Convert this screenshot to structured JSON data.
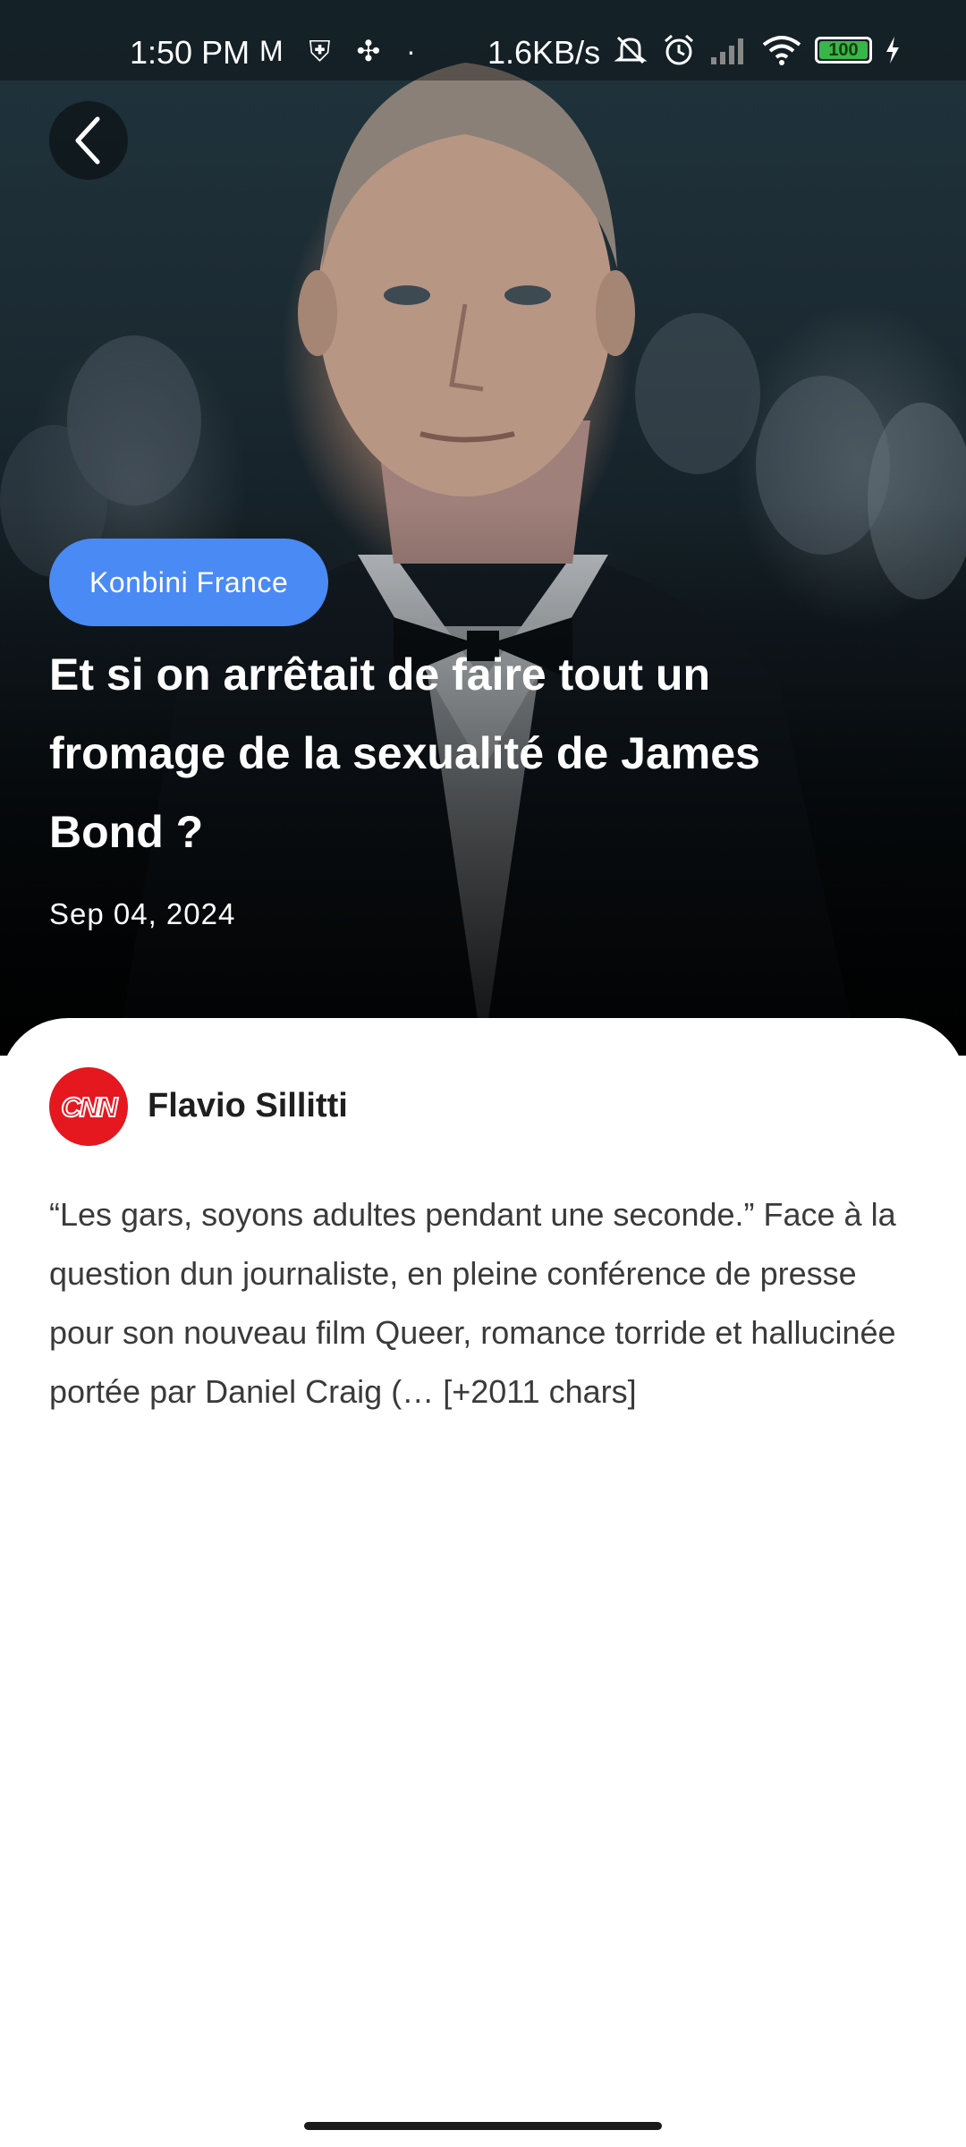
{
  "status_bar": {
    "time": "1:50 PM",
    "left_icons": "M ⛨ ✣ ·",
    "network_speed": "1.6KB/s",
    "battery_level": "100",
    "icons": [
      "gmail-icon",
      "notification-icon",
      "app-icon",
      "mute-icon",
      "alarm-icon",
      "signal-icon",
      "wifi-icon",
      "battery-icon",
      "charging-icon"
    ]
  },
  "article": {
    "source_badge": "Konbini France",
    "headline": "Et si on arrêtait de faire tout un fromage de la sexualité de James Bond ?",
    "date": "Sep 04, 2024",
    "author": "Flavio Sillitti",
    "body": "“Les gars, soyons adultes pendant une seconde.” Face à la question dun journaliste, en pleine conférence de presse pour son nouveau film Queer, romance torride et hallucinée portée par Daniel Craig (… [+2011 chars]",
    "publisher_logo_text": "CNN"
  },
  "colors": {
    "badge_bg": "#4a8af4",
    "cnn_red": "#e5171f",
    "battery_green": "#39b54a"
  }
}
